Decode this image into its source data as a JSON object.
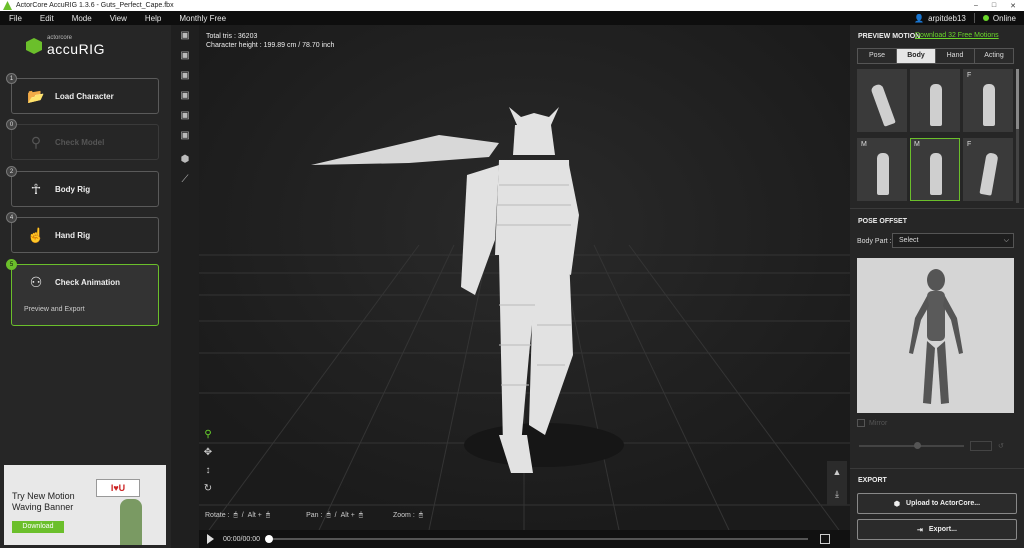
{
  "window": {
    "title": "ActorCore AccuRIG 1.3.6 - Guts_Perfect_Cape.fbx",
    "controls": [
      "–",
      "□",
      "✕"
    ]
  },
  "menu": {
    "items": [
      "File",
      "Edit",
      "Mode",
      "View",
      "Help",
      "Monthly Free"
    ],
    "username": "arpitdeb13",
    "status": "Online"
  },
  "brand": {
    "small": "actorcore",
    "big": "accuRIG"
  },
  "steps": [
    {
      "num": "1",
      "label": "Load Character"
    },
    {
      "num": "0",
      "label": "Check Model"
    },
    {
      "num": "2",
      "label": "Body Rig"
    },
    {
      "num": "4",
      "label": "Hand Rig"
    },
    {
      "num": "5",
      "label": "Check Animation",
      "sub": "Preview and Export"
    }
  ],
  "banner": {
    "line1": "Try New Motion",
    "line2": "Waving Banner",
    "button": "Download",
    "sign": "I♥U"
  },
  "viewport": {
    "total_tris": "Total tris : 36203",
    "char_height": "Character height : 199.89 cm / 78.70 inch",
    "hint_rotate": "Rotate :",
    "hint_pan": "Pan :",
    "hint_zoom": "Zoom :",
    "alt": "Alt +",
    "slash": "/"
  },
  "timeline": {
    "time": "00:00/00:00"
  },
  "right": {
    "preview_motion": "PREVIEW MOTION",
    "download_link": "Download 32 Free Motions",
    "tabs": [
      "Pose",
      "Body",
      "Hand",
      "Acting"
    ],
    "thumbs": [
      {
        "tag": ""
      },
      {
        "tag": ""
      },
      {
        "tag": "F"
      },
      {
        "tag": "M"
      },
      {
        "tag": "M"
      },
      {
        "tag": "F"
      }
    ],
    "pose_offset": "POSE OFFSET",
    "body_part_label": "Body Part :",
    "body_part_value": "Select",
    "mirror": "Mirror",
    "export_header": "EXPORT",
    "upload_button": "Upload to ActorCore...",
    "export_button": "Export..."
  }
}
